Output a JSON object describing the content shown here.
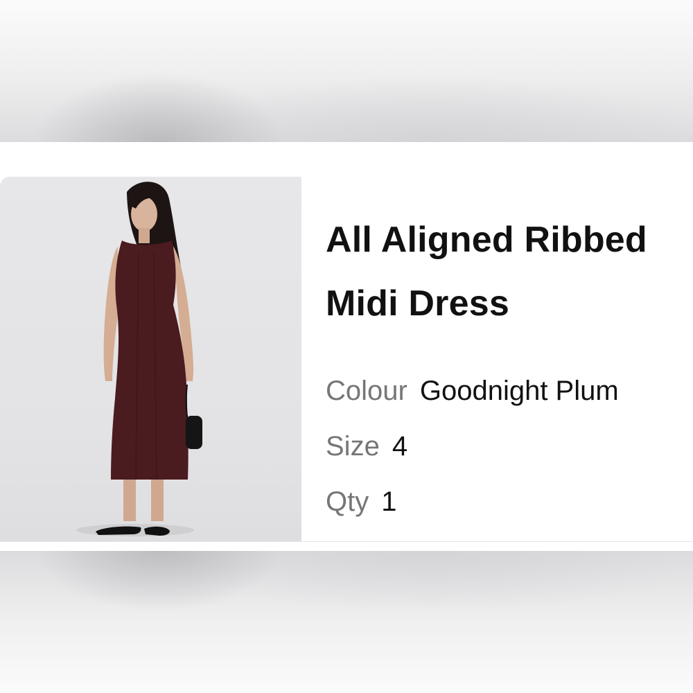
{
  "product": {
    "title_line1": "All Aligned Ribbed",
    "title_line2": "Midi Dress",
    "image_alt": "Model wearing sleeveless ribbed midi dress in plum",
    "attributes": {
      "colour_label": "Colour",
      "colour_value": "Goodnight Plum",
      "size_label": "Size",
      "size_value": "4",
      "qty_label": "Qty",
      "qty_value": "1"
    }
  },
  "colors": {
    "dress": "#4a1b1f",
    "image_bg": "#e5e5e7",
    "text_primary": "#111111",
    "text_secondary": "#767676"
  }
}
